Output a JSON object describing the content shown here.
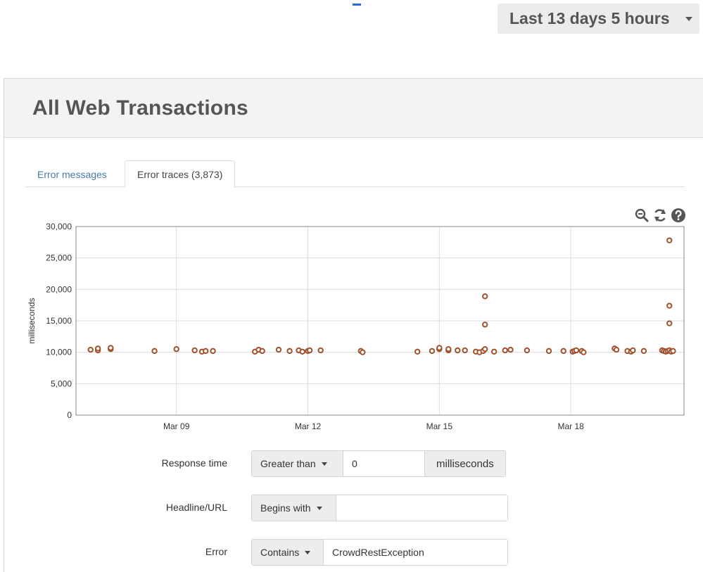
{
  "time_picker": {
    "label": "Last 13 days 5 hours",
    "icon": "caret-down-icon"
  },
  "panel": {
    "title": "All Web Transactions"
  },
  "tabs": [
    {
      "label": "Error messages",
      "active": false
    },
    {
      "label": "Error traces (3,873)",
      "active": true
    }
  ],
  "chart_tools": {
    "zoom": "zoom-out-icon",
    "refresh": "refresh-icon",
    "help": "help-icon"
  },
  "chart_data": {
    "type": "scatter",
    "title": "",
    "xlabel": "",
    "ylabel": "milliseconds",
    "ylim": [
      0,
      30000
    ],
    "y_ticks": [
      "0",
      "5,000",
      "10,000",
      "15,000",
      "20,000",
      "25,000",
      "30,000"
    ],
    "xlim": [
      "2021-03-06T17:00",
      "2021-03-20T14:00"
    ],
    "x_ticks": [
      {
        "date": "2021-03-09",
        "label": "Mar 09"
      },
      {
        "date": "2021-03-12",
        "label": "Mar 12"
      },
      {
        "date": "2021-03-15",
        "label": "Mar 15"
      },
      {
        "date": "2021-03-18",
        "label": "Mar 18"
      }
    ],
    "grid": true,
    "marker_color": "#a0522d",
    "points": [
      [
        "2021-03-07T01:00",
        10400
      ],
      [
        "2021-03-07T05:00",
        10300
      ],
      [
        "2021-03-07T05:00",
        10600
      ],
      [
        "2021-03-07T12:00",
        10500
      ],
      [
        "2021-03-07T12:00",
        10700
      ],
      [
        "2021-03-08T12:00",
        10200
      ],
      [
        "2021-03-09T00:00",
        10500
      ],
      [
        "2021-03-09T10:00",
        10300
      ],
      [
        "2021-03-09T14:00",
        10100
      ],
      [
        "2021-03-09T16:00",
        10200
      ],
      [
        "2021-03-09T20:00",
        10200
      ],
      [
        "2021-03-10T19:00",
        10100
      ],
      [
        "2021-03-10T21:00",
        10400
      ],
      [
        "2021-03-10T23:00",
        10200
      ],
      [
        "2021-03-11T08:00",
        10400
      ],
      [
        "2021-03-11T14:00",
        10200
      ],
      [
        "2021-03-11T19:00",
        10300
      ],
      [
        "2021-03-11T21:00",
        10100
      ],
      [
        "2021-03-12T00:00",
        10200
      ],
      [
        "2021-03-12T01:00",
        10300
      ],
      [
        "2021-03-12T07:00",
        10300
      ],
      [
        "2021-03-13T05:00",
        10200
      ],
      [
        "2021-03-13T06:00",
        10000
      ],
      [
        "2021-03-14T12:00",
        10100
      ],
      [
        "2021-03-14T20:00",
        10200
      ],
      [
        "2021-03-15T00:00",
        10500
      ],
      [
        "2021-03-15T00:00",
        10700
      ],
      [
        "2021-03-15T05:00",
        10300
      ],
      [
        "2021-03-15T05:00",
        10500
      ],
      [
        "2021-03-15T10:00",
        10300
      ],
      [
        "2021-03-15T14:00",
        10300
      ],
      [
        "2021-03-15T20:00",
        10100
      ],
      [
        "2021-03-15T22:00",
        10000
      ],
      [
        "2021-03-16T00:00",
        10200
      ],
      [
        "2021-03-16T01:00",
        10500
      ],
      [
        "2021-03-16T01:00",
        14400
      ],
      [
        "2021-03-16T01:00",
        18900
      ],
      [
        "2021-03-16T06:00",
        10100
      ],
      [
        "2021-03-16T12:00",
        10300
      ],
      [
        "2021-03-16T15:00",
        10400
      ],
      [
        "2021-03-17T00:00",
        10300
      ],
      [
        "2021-03-17T12:00",
        10200
      ],
      [
        "2021-03-17T20:00",
        10200
      ],
      [
        "2021-03-18T01:00",
        10100
      ],
      [
        "2021-03-18T02:00",
        10200
      ],
      [
        "2021-03-18T03:00",
        10300
      ],
      [
        "2021-03-18T06:00",
        10200
      ],
      [
        "2021-03-18T07:00",
        10000
      ],
      [
        "2021-03-19T00:00",
        10600
      ],
      [
        "2021-03-19T01:00",
        10400
      ],
      [
        "2021-03-19T07:00",
        10200
      ],
      [
        "2021-03-19T09:00",
        10100
      ],
      [
        "2021-03-19T10:00",
        10300
      ],
      [
        "2021-03-19T16:00",
        10200
      ],
      [
        "2021-03-20T02:00",
        10300
      ],
      [
        "2021-03-20T03:00",
        10200
      ],
      [
        "2021-03-20T04:00",
        10100
      ],
      [
        "2021-03-20T05:00",
        10200
      ],
      [
        "2021-03-20T06:00",
        10300
      ],
      [
        "2021-03-20T07:00",
        10100
      ],
      [
        "2021-03-20T08:00",
        10200
      ],
      [
        "2021-03-20T06:00",
        14600
      ],
      [
        "2021-03-20T06:00",
        17400
      ],
      [
        "2021-03-20T06:00",
        27800
      ]
    ]
  },
  "filters": [
    {
      "label": "Response time",
      "operator": "Greater than",
      "value": "0",
      "unit": "milliseconds"
    },
    {
      "label": "Headline/URL",
      "operator": "Begins with",
      "value": ""
    },
    {
      "label": "Error",
      "operator": "Contains",
      "value": "CrowdRestException"
    }
  ]
}
